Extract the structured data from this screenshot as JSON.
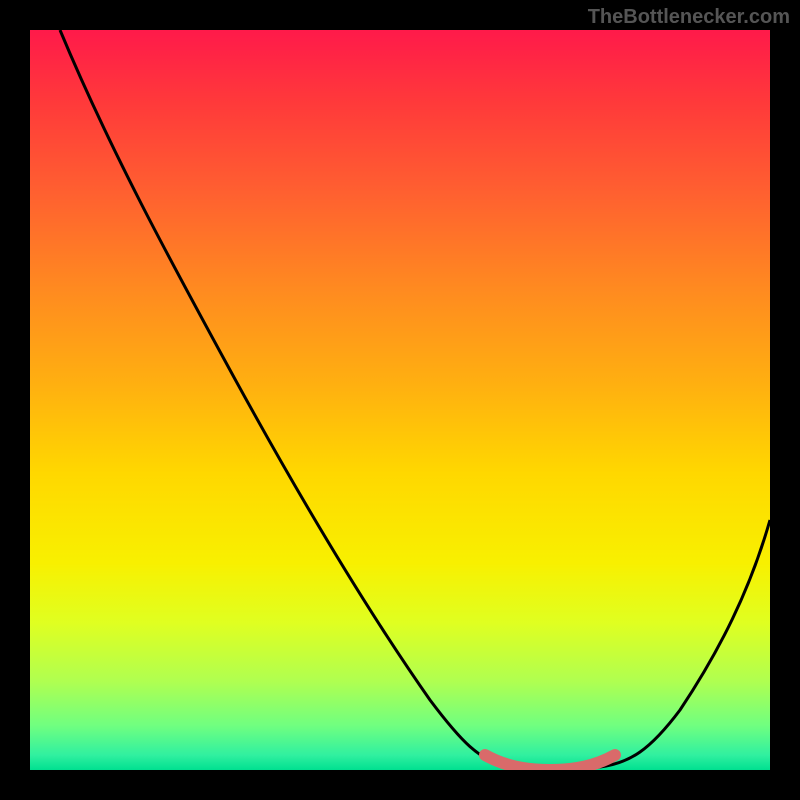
{
  "watermark": "TheBottlenecker.com",
  "chart_data": {
    "type": "line",
    "title": "",
    "xlabel": "",
    "ylabel": "",
    "xlim": [
      0,
      100
    ],
    "ylim": [
      0,
      100
    ],
    "series": [
      {
        "name": "bottleneck-curve",
        "x": [
          4,
          10,
          20,
          30,
          40,
          50,
          56,
          60,
          64,
          68,
          72,
          76,
          80,
          85,
          90,
          95,
          100
        ],
        "values": [
          100,
          90,
          75,
          60,
          45,
          30,
          18,
          10,
          4,
          1,
          0,
          0,
          1,
          4,
          12,
          22,
          35
        ]
      },
      {
        "name": "optimal-range-highlight",
        "x": [
          62,
          66,
          70,
          74,
          78,
          82
        ],
        "values": [
          3,
          1,
          0,
          0,
          1,
          3
        ]
      }
    ],
    "gradient_stops": [
      {
        "pos": 0.0,
        "color": "#ff1a4a"
      },
      {
        "pos": 0.22,
        "color": "#ff6030"
      },
      {
        "pos": 0.48,
        "color": "#ffb010"
      },
      {
        "pos": 0.72,
        "color": "#f8f000"
      },
      {
        "pos": 0.94,
        "color": "#70ff80"
      },
      {
        "pos": 1.0,
        "color": "#00e090"
      }
    ]
  }
}
